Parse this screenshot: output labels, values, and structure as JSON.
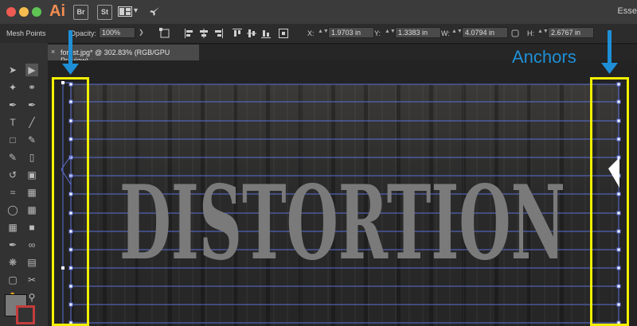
{
  "titlebar": {
    "app_logo": "Ai",
    "bridge_label": "Br",
    "stock_label": "St",
    "workspace": "Esse"
  },
  "controlbar": {
    "mesh_points_label": "Mesh Points",
    "opacity_label": "Opacity:",
    "opacity_value": "100%",
    "x_label": "X:",
    "x_value": "1.9703 in",
    "y_label": "Y:",
    "y_value": "1.3383 in",
    "w_label": "W:",
    "w_value": "4.0794 in",
    "h_label": "H:",
    "h_value": "2.6767 in"
  },
  "document": {
    "tab_title": "forest.jpg* @ 302.83% (RGB/GPU Preview)",
    "artwork_text": "DISTORTION"
  },
  "annotation": {
    "label": "Anchors",
    "color": "#1e8fd6",
    "highlight_color": "#f2f000"
  },
  "colors": {
    "mesh_line": "#5c6fd6",
    "text_fill": "#7a7a7a"
  }
}
